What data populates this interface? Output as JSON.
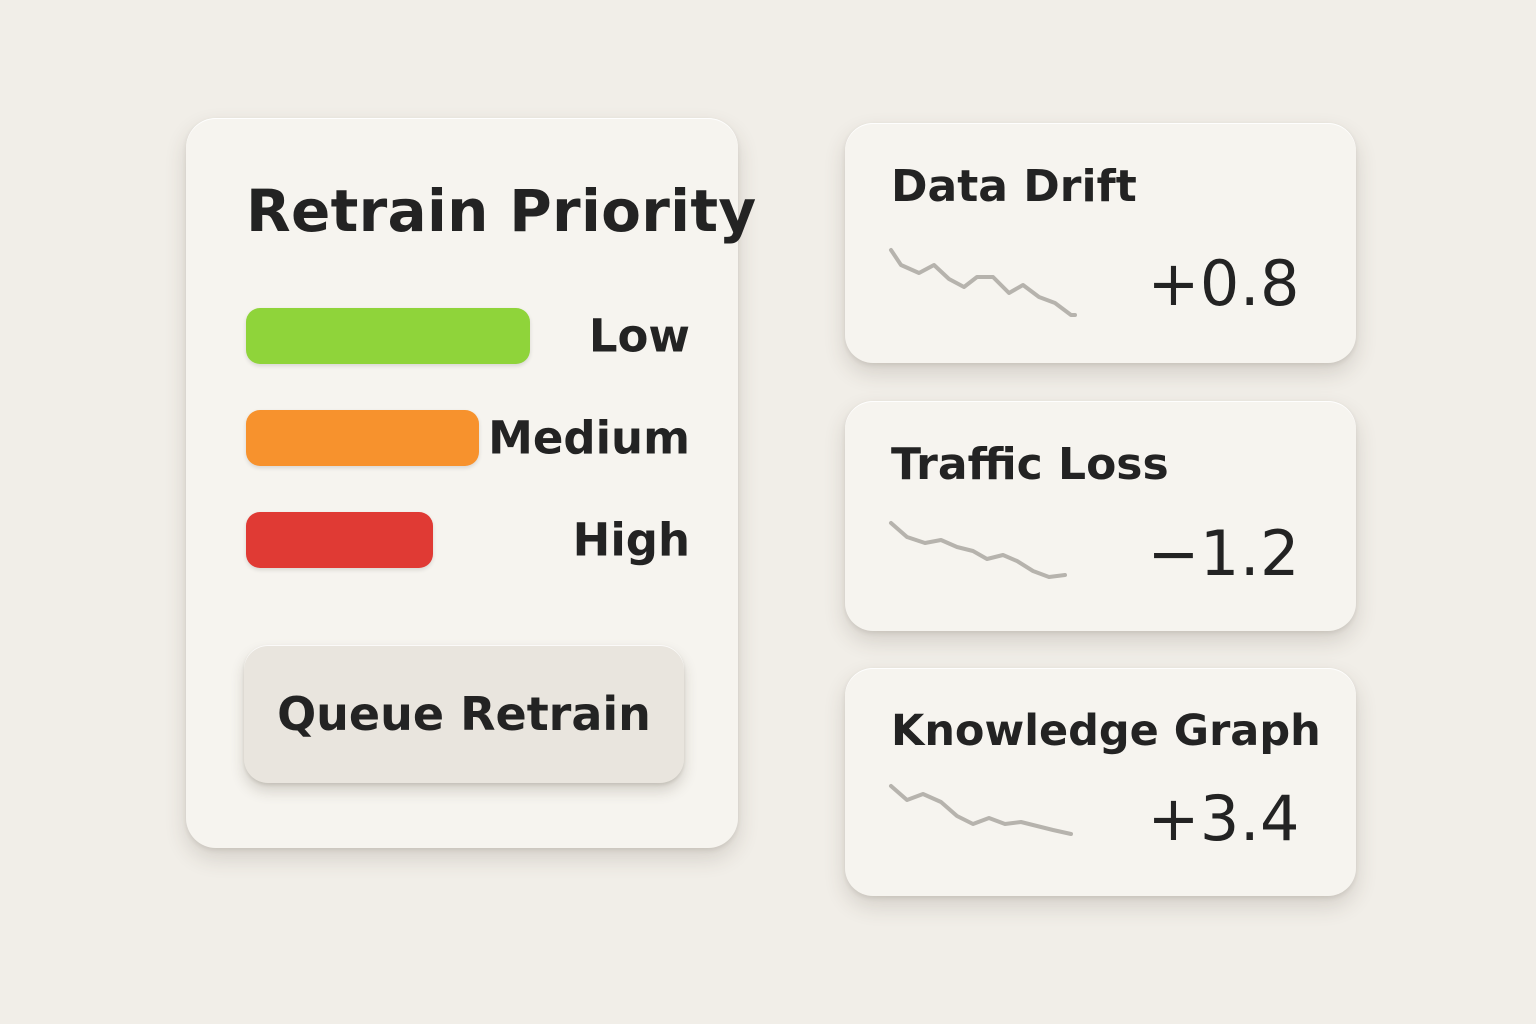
{
  "priority_panel": {
    "title": "Retrain Priority",
    "levels": [
      {
        "label": "Low",
        "color": "#8fd43a",
        "fill": 1.0
      },
      {
        "label": "Medium",
        "color": "#f7922d",
        "fill": 0.82
      },
      {
        "label": "High",
        "color": "#e03a34",
        "fill": 0.66
      }
    ],
    "queue_button_label": "Queue Retrain"
  },
  "metrics": [
    {
      "title": "Data Drift",
      "value": "+0.8",
      "trend_icon": "sparkline-down-icon"
    },
    {
      "title": "Traffic Loss",
      "value": "−1.2",
      "trend_icon": "sparkline-down-icon"
    },
    {
      "title": "Knowledge Graph",
      "value": "+3.4",
      "trend_icon": "sparkline-down-icon"
    }
  ]
}
